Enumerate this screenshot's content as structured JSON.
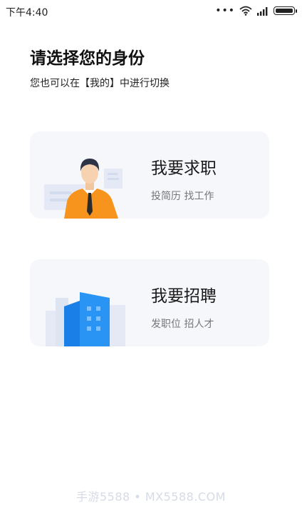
{
  "status_bar": {
    "time": "下午4:40",
    "dots": "•••",
    "icons": [
      "wifi-icon",
      "signal-icon",
      "battery-icon"
    ]
  },
  "header": {
    "title": "请选择您的身份",
    "subtitle": "您也可以在【我的】中进行切换"
  },
  "cards": [
    {
      "title": "我要求职",
      "desc": "投简历 找工作",
      "icon": "job-seeker-illustration"
    },
    {
      "title": "我要招聘",
      "desc": "发职位 招人才",
      "icon": "building-illustration"
    }
  ],
  "watermark": "手游5588 • MX5588.COM",
  "colors": {
    "card_bg": "#f6f7fb",
    "person_shirt": "#f7941d",
    "building_blue": "#1e8cf0"
  }
}
